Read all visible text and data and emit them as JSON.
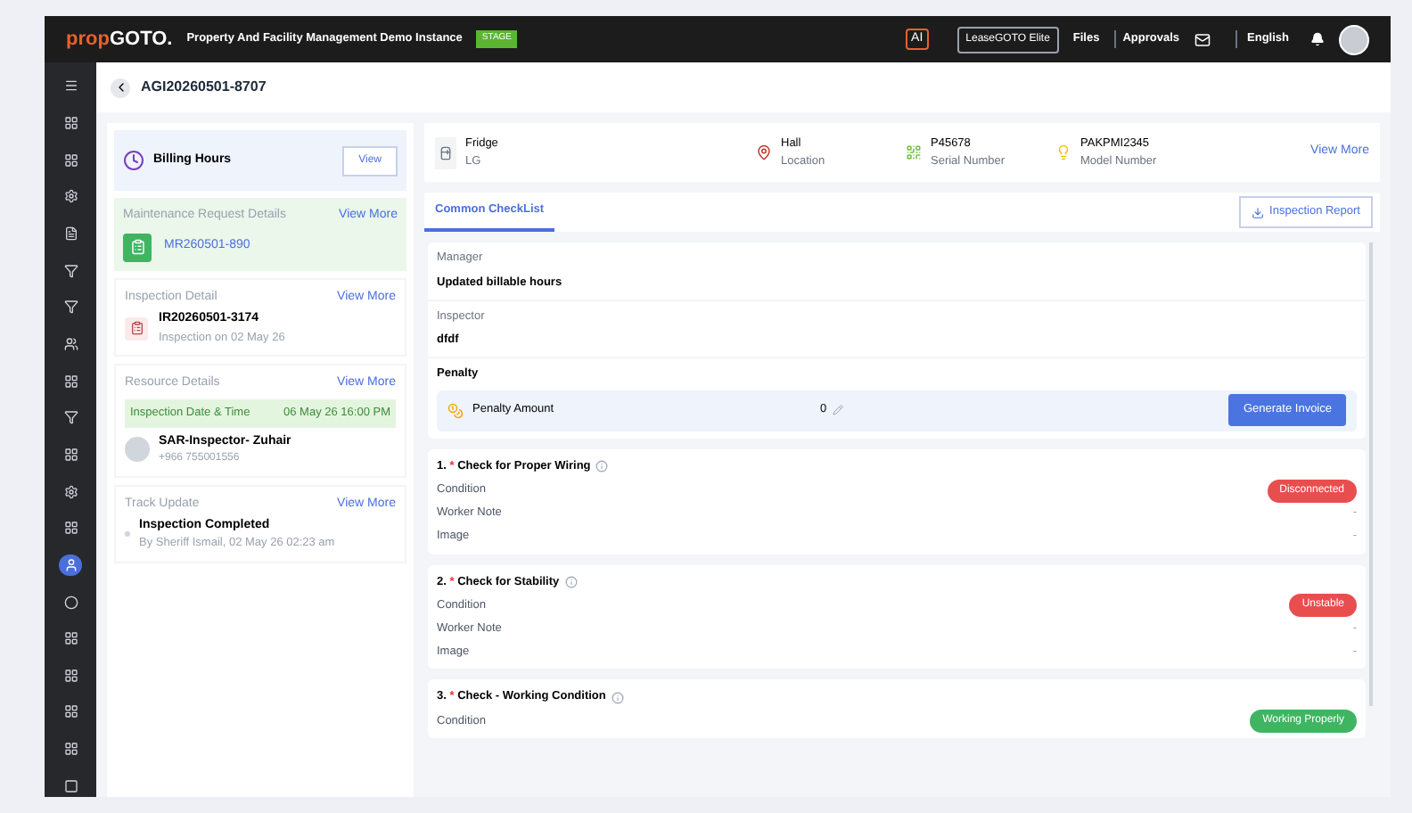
{
  "topbar": {
    "logo_prefix": "prop",
    "logo_suffix": "GOTO.",
    "title": "Property And Facility Management Demo Instance",
    "env_badge": "STAGE",
    "ai_label": "AI",
    "plan_button": "LeaseGOTO Elite",
    "links": [
      "Files",
      "Approvals"
    ],
    "language": "English"
  },
  "sidebar": {
    "items": [
      {
        "kind": "menu",
        "selected": false
      },
      {
        "kind": "grid",
        "selected": false
      },
      {
        "kind": "grid",
        "selected": false
      },
      {
        "kind": "gear",
        "selected": false
      },
      {
        "kind": "doc",
        "selected": false
      },
      {
        "kind": "filter",
        "selected": false
      },
      {
        "kind": "filter",
        "selected": false
      },
      {
        "kind": "users",
        "selected": false
      },
      {
        "kind": "grid",
        "selected": false
      },
      {
        "kind": "filter",
        "selected": false
      },
      {
        "kind": "grid",
        "selected": false
      },
      {
        "kind": "gear",
        "selected": false
      },
      {
        "kind": "grid",
        "selected": false
      },
      {
        "kind": "person",
        "selected": true
      },
      {
        "kind": "circle",
        "selected": false
      },
      {
        "kind": "grid",
        "selected": false
      },
      {
        "kind": "grid",
        "selected": false
      },
      {
        "kind": "grid",
        "selected": false
      },
      {
        "kind": "grid",
        "selected": false
      },
      {
        "kind": "outline",
        "selected": false
      }
    ]
  },
  "page": {
    "title": "AGI20260501-8707"
  },
  "left": {
    "billing": {
      "title": "Billing Hours",
      "button": "View"
    },
    "maintenance": {
      "title": "Maintenance Request Details",
      "link": "View More",
      "number": "MR260501-890"
    },
    "inspection": {
      "title": "Inspection Detail",
      "link": "View More",
      "number": "IR20260501-3174",
      "subtitle": "Inspection on 02 May 26"
    },
    "resource": {
      "title": "Resource Details",
      "link": "View More",
      "date_label": "Inspection Date & Time",
      "date_value": "06 May 26 16:00 PM",
      "name": "SAR-Inspector- Zuhair",
      "phone": "+966 755001556"
    },
    "track": {
      "title": "Track Update",
      "link": "View More",
      "status": "Inspection Completed",
      "meta": "By Sheriff Ismail, 02 May 26 02:23 am"
    }
  },
  "asset": {
    "name": "Fridge",
    "brand": "LG",
    "fields": [
      {
        "kind": "location",
        "value": "Hall",
        "label": "Location"
      },
      {
        "kind": "serial",
        "value": "P45678",
        "label": "Serial Number"
      },
      {
        "kind": "model",
        "value": "PAKPMI2345",
        "label": "Model Number"
      }
    ],
    "link": "View More"
  },
  "tabs": [
    {
      "label": "Common CheckList",
      "selected": true
    }
  ],
  "report_button": "Inspection Report",
  "notes": [
    {
      "label": "Manager",
      "value": "Updated billable hours"
    },
    {
      "label": "Inspector",
      "value": "dfdf"
    }
  ],
  "penalty": {
    "title": "Penalty",
    "label": "Penalty Amount",
    "amount": "0",
    "button": "Generate Invoice"
  },
  "checks": [
    {
      "number": "1.",
      "required_mark": "*",
      "title": "Check for Proper Wiring",
      "rows": [
        {
          "kind": "badge",
          "label": "Condition",
          "value": "Disconnected",
          "color": "#e94e4e"
        },
        {
          "kind": "text",
          "label": "Worker Note",
          "value": "-"
        },
        {
          "kind": "text",
          "label": "Image",
          "value": "-"
        }
      ]
    },
    {
      "number": "2.",
      "required_mark": "*",
      "title": "Check for Stability",
      "rows": [
        {
          "kind": "badge",
          "label": "Condition",
          "value": "Unstable",
          "color": "#e94e4e"
        },
        {
          "kind": "text",
          "label": "Worker Note",
          "value": "-"
        },
        {
          "kind": "text",
          "label": "Image",
          "value": "-"
        }
      ]
    },
    {
      "number": "3.",
      "required_mark": "*",
      "title": "Check - Working Condition",
      "rows": [
        {
          "kind": "badge",
          "label": "Condition",
          "value": "Working Properly",
          "color": "#3fb561"
        }
      ]
    }
  ]
}
